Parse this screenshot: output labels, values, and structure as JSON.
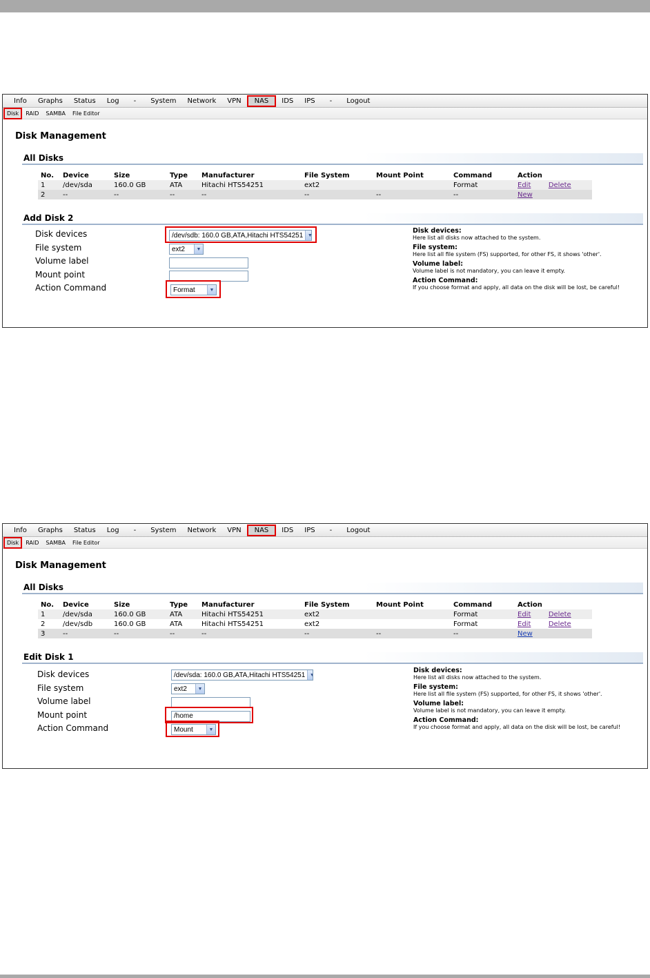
{
  "menu": {
    "items": [
      "Info",
      "Graphs",
      "Status",
      "Log",
      "-",
      "System",
      "Network",
      "VPN",
      "NAS",
      "IDS",
      "IPS",
      "-",
      "Logout"
    ],
    "active": "NAS"
  },
  "submenu": {
    "items": [
      "Disk",
      "RAID",
      "SAMBA",
      "File Editor"
    ],
    "active": "Disk"
  },
  "page_title": "Disk Management",
  "all_disks": {
    "heading": "All Disks",
    "columns": [
      "No.",
      "Device",
      "Size",
      "Type",
      "Manufacturer",
      "File System",
      "Mount Point",
      "Command",
      "Action"
    ]
  },
  "help": {
    "disk_devices_title": "Disk devices:",
    "disk_devices_text": "Here list all disks now attached to the system.",
    "file_system_title": "File system:",
    "file_system_text": "Here list all file system (FS) supported, for other FS, it shows 'other'.",
    "volume_label_title": "Volume label:",
    "volume_label_text": "Volume label is not mandatory, you can leave it empty.",
    "action_command_title": "Action Command:",
    "action_command_text": "If you choose format and apply, all data on the disk will be lost, be careful!"
  },
  "form_labels": {
    "disk_devices": "Disk devices",
    "file_system": "File system",
    "volume_label": "Volume label",
    "mount_point": "Mount point",
    "action_command": "Action Command"
  },
  "action_links": {
    "edit": "Edit",
    "delete": "Delete",
    "new": "New"
  },
  "screen1": {
    "rows": [
      {
        "no": "1",
        "device": "/dev/sda",
        "size": "160.0 GB",
        "type": "ATA",
        "manufacturer": "Hitachi HTS54251",
        "fs": "ext2",
        "mount": "",
        "command": "Format"
      },
      {
        "no": "2",
        "device": "--",
        "size": "--",
        "type": "--",
        "manufacturer": "--",
        "fs": "--",
        "mount": "--",
        "command": "--"
      }
    ],
    "form_heading": "Add Disk 2",
    "disk_device_value": "/dev/sdb: 160.0 GB,ATA,Hitachi HTS54251",
    "file_system_value": "ext2",
    "volume_label_value": "",
    "mount_point_value": "",
    "action_command_value": "Format"
  },
  "screen2": {
    "rows": [
      {
        "no": "1",
        "device": "/dev/sda",
        "size": "160.0 GB",
        "type": "ATA",
        "manufacturer": "Hitachi HTS54251",
        "fs": "ext2",
        "mount": "",
        "command": "Format"
      },
      {
        "no": "2",
        "device": "/dev/sdb",
        "size": "160.0 GB",
        "type": "ATA",
        "manufacturer": "Hitachi HTS54251",
        "fs": "ext2",
        "mount": "",
        "command": "Format"
      },
      {
        "no": "3",
        "device": "--",
        "size": "--",
        "type": "--",
        "manufacturer": "--",
        "fs": "--",
        "mount": "--",
        "command": "--"
      }
    ],
    "form_heading": "Edit Disk 1",
    "disk_device_value": "/dev/sda: 160.0 GB,ATA,Hitachi HTS54251",
    "file_system_value": "ext2",
    "volume_label_value": "",
    "mount_point_value": "/home",
    "action_command_value": "Mount"
  },
  "colors": {
    "highlight": "#e00000",
    "link_visited": "#6a2a8e",
    "link": "#1a3fb5",
    "section_rule": "#9fb3cc"
  },
  "icons": [
    "dropdown-arrow-icon"
  ]
}
